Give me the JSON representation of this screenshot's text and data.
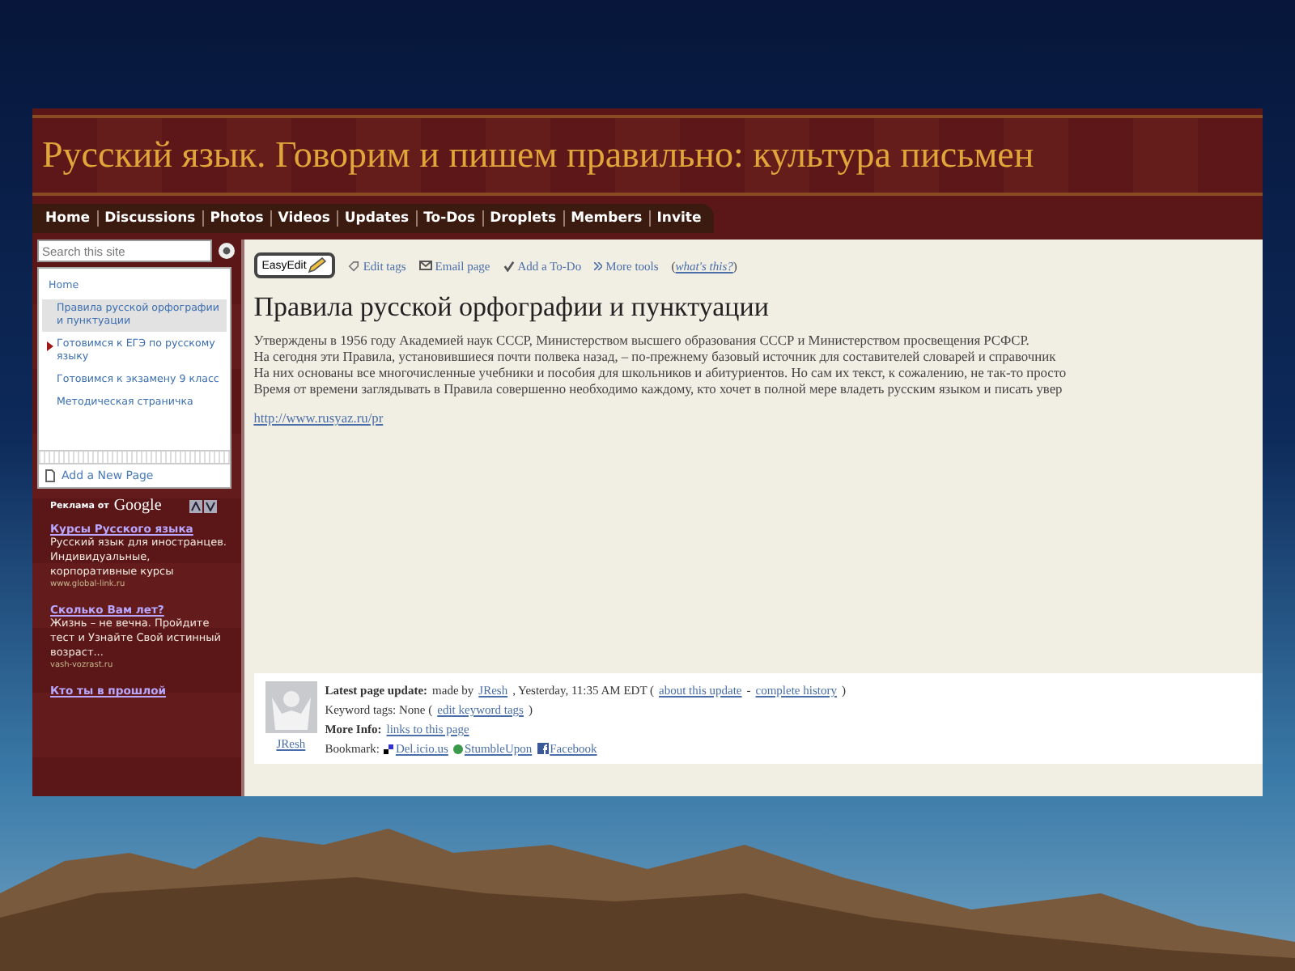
{
  "site": {
    "title": "Русский язык. Говорим и пишем правильно: культура письмен"
  },
  "nav": [
    {
      "label": "Home"
    },
    {
      "label": "Discussions"
    },
    {
      "label": "Photos"
    },
    {
      "label": "Videos"
    },
    {
      "label": "Updates"
    },
    {
      "label": "To-Dos"
    },
    {
      "label": "Droplets"
    },
    {
      "label": "Members"
    },
    {
      "label": "Invite"
    }
  ],
  "sidebar": {
    "search": {
      "placeholder": "Search this site"
    },
    "items": [
      {
        "label": "Home",
        "selected": false,
        "expandable": false,
        "children": [
          {
            "label": "Правила русской орфографии и пунктуации",
            "selected": true,
            "expandable": false
          },
          {
            "label": "Готовимся к ЕГЭ по русскому языку",
            "selected": false,
            "expandable": true
          },
          {
            "label": "Готовимся к экзамену 9 класс",
            "selected": false,
            "expandable": false
          },
          {
            "label": "Методическая страничка",
            "selected": false,
            "expandable": false
          }
        ]
      }
    ],
    "add_page": "Add a New Page",
    "ads_label": "Реклама от",
    "ads_brand": "Google",
    "ads": [
      {
        "title": "Курсы Русского языка",
        "body": "Русский язык для иностранцев. Индивидуальные, корпоративные курсы",
        "url": "www.global-link.ru"
      },
      {
        "title": "Сколько Вам лет?",
        "body": "Жизнь – не вечна. Пройдите тест и Узнайте Свой истинный возраст...",
        "url": "vash-vozrast.ru"
      },
      {
        "title": "Кто ты в прошлой"
      }
    ]
  },
  "toolbar": {
    "easyedit": "EasyEdit",
    "tools": [
      {
        "label": "Edit tags",
        "kind": "tag"
      },
      {
        "label": "Email page",
        "kind": "mail"
      },
      {
        "label": "Add a To-Do",
        "kind": "todo"
      },
      {
        "label": "More tools",
        "kind": "more"
      }
    ],
    "help": {
      "open": "(",
      "link": "what's this?",
      "close": ")"
    }
  },
  "page": {
    "title": "Правила русской орфографии и пунктуации",
    "paragraphs": [
      "Утверждены в 1956 году Академией наук СССР, Министерством высшего образования СССР и Министерством просвещения РСФСР.",
      "На сегодня эти Правила, установившиеся почти полвека назад, – по-прежнему базовый источник для составителей словарей и справочник",
      "На них основаны все многочисленные учебники и пособия для школьников и абитуриентов. Но сам их текст, к сожалению, не так-то просто",
      "Время от времени заглядывать в Правила совершенно необходимо каждому, кто хочет в полной мере владеть русским языком и писать увер"
    ],
    "link": "http://www.rusyaz.ru/pr"
  },
  "footer": {
    "author": "JResh",
    "lines": [
      [
        {
          "kind": "bold",
          "text": "Latest page update:"
        },
        {
          "kind": "text",
          "text": "made by"
        },
        {
          "kind": "link",
          "text": "JResh"
        },
        {
          "kind": "text",
          "text": ", Yesterday, 11:35 AM EDT ("
        },
        {
          "kind": "link",
          "text": "about this update"
        },
        {
          "kind": "text",
          "text": "-"
        },
        {
          "kind": "link",
          "text": "complete history"
        },
        {
          "kind": "text",
          "text": ")"
        }
      ],
      [
        {
          "kind": "text",
          "text": "Keyword tags: None ("
        },
        {
          "kind": "link",
          "text": "edit keyword tags"
        },
        {
          "kind": "text",
          "text": ")"
        }
      ],
      [
        {
          "kind": "bold",
          "text": "More Info:"
        },
        {
          "kind": "link",
          "text": "links to this page"
        }
      ],
      [
        {
          "kind": "text",
          "text": "Bookmark:"
        },
        {
          "kind": "bookmark",
          "text": "Del.icio.us"
        },
        {
          "kind": "bookmark",
          "text": "StumbleUpon"
        },
        {
          "kind": "bookmark",
          "text": "Facebook"
        }
      ]
    ]
  }
}
